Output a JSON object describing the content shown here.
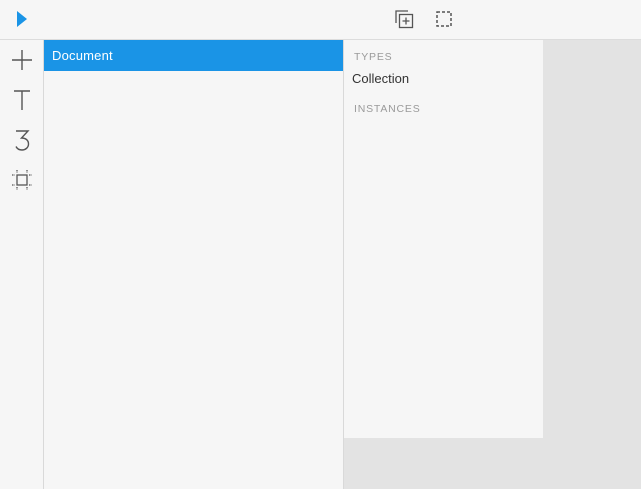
{
  "toolbar": {
    "icons": [
      "play-icon",
      "duplicate-icon",
      "dashed-selection-icon"
    ],
    "accent_color": "#1a94e6"
  },
  "tools": [
    "plus-icon",
    "text-icon",
    "number-icon",
    "frame-icon"
  ],
  "tree": {
    "items": [
      {
        "label": "Document",
        "selected": true
      }
    ]
  },
  "types_panel": {
    "types_heading": "TYPES",
    "types": [
      "Collection"
    ],
    "instances_heading": "INSTANCES"
  }
}
